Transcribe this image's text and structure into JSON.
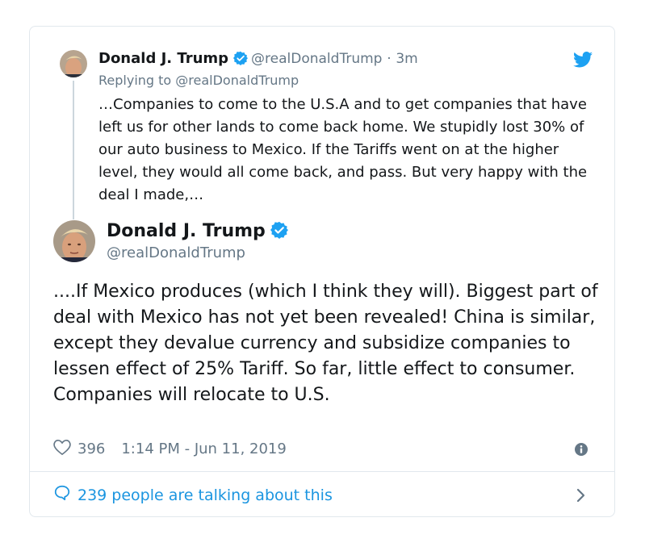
{
  "reply_tweet": {
    "name": "Donald J. Trump",
    "handle": "@realDonaldTrump",
    "separator": "·",
    "time": "3m",
    "replying_to": "Replying to @realDonaldTrump",
    "text": "…Companies to come to the U.S.A and to get companies that have left us for other lands to come back home. We stupidly lost 30% of our auto business to Mexico. If the Tariffs went on at the higher level, they would all come back, and pass. But very happy with the deal I made,…"
  },
  "main_tweet": {
    "name": "Donald J. Trump",
    "handle": "@realDonaldTrump",
    "text": "....If Mexico produces (which I think they will). Biggest part of deal with Mexico has not yet been revealed! China is similar, except they devalue currency and subsidize companies to lessen effect of 25% Tariff. So far, little effect to consumer. Companies will relocate to U.S.",
    "likes": "396",
    "timestamp": "1:14 PM - Jun 11, 2019"
  },
  "footer": {
    "talking": "239 people are talking about this"
  },
  "icons": {
    "verified": "verified-badge-icon",
    "bird": "twitter-bird-icon",
    "heart": "heart-icon",
    "info": "info-icon",
    "bubble": "speech-bubble-icon",
    "chevron": "chevron-right-icon"
  },
  "colors": {
    "accent": "#1da1f2",
    "link": "#1b95e0",
    "muted": "#657786",
    "text": "#14171a",
    "border": "#e1e8ed"
  }
}
